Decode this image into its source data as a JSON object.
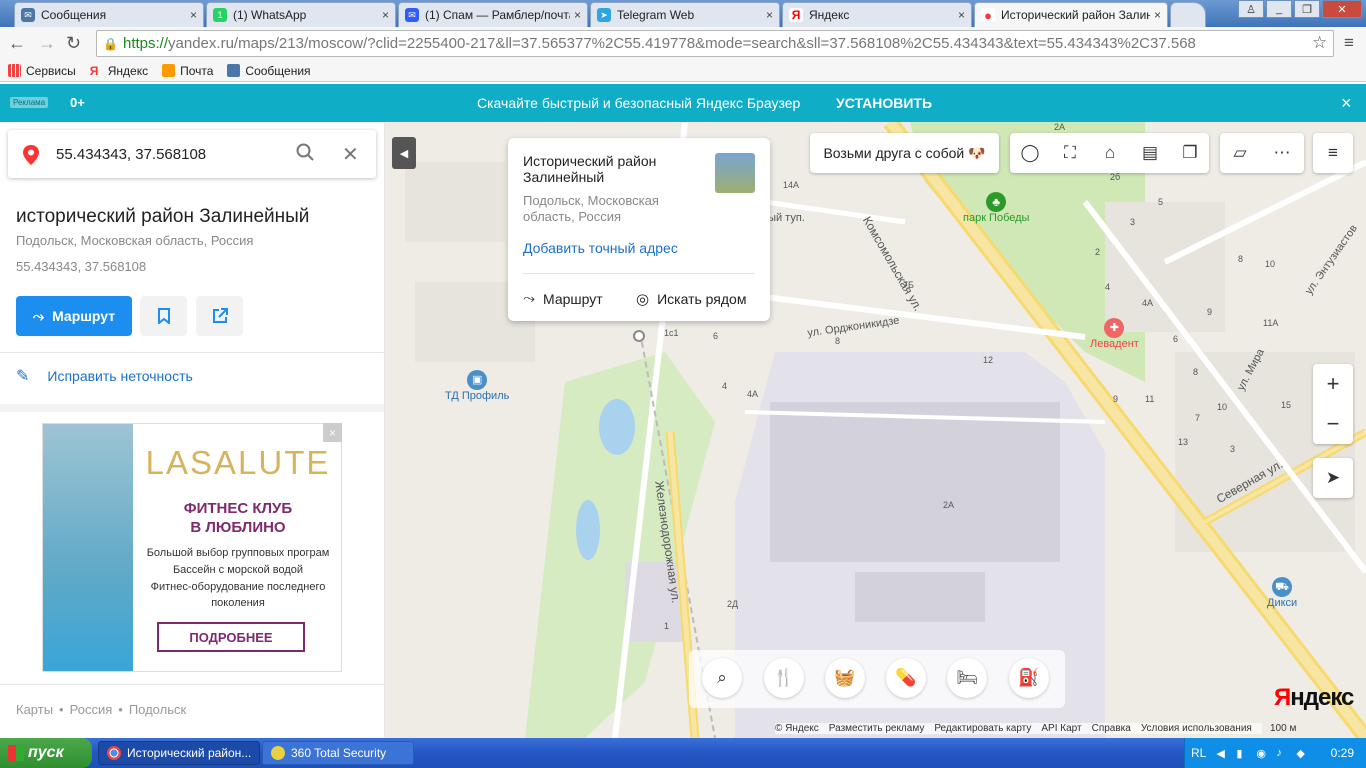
{
  "browser": {
    "tabs": [
      {
        "label": "Сообщения",
        "icon": "message-icon",
        "color": "#4a76a8"
      },
      {
        "label": "(1) WhatsApp",
        "icon": "whatsapp-icon",
        "color": "#25d366"
      },
      {
        "label": "(1) Спам — Рамблер/почта",
        "icon": "mail-icon",
        "color": "#315efb"
      },
      {
        "label": "Telegram Web",
        "icon": "telegram-icon",
        "color": "#2ca5e0"
      },
      {
        "label": "Яндекс",
        "icon": "yandex-icon",
        "color": "#ff0000"
      },
      {
        "label": "Исторический район Залин",
        "icon": "map-pin-icon",
        "color": "#ff3333"
      }
    ],
    "tab_close": "×",
    "url_scheme": "https://",
    "url_rest": "yandex.ru/maps/213/moscow/?clid=2255400-217&ll=37.565377%2C55.419778&mode=search&sll=37.568108%2C55.434343&text=55.434343%2C37.568",
    "bookmarks": [
      {
        "label": "Сервисы",
        "icon": "apps-icon",
        "color": "#e44"
      },
      {
        "label": "Яндекс",
        "icon": "yandex-icon",
        "color": "#f33"
      },
      {
        "label": "Почта",
        "icon": "mail-icon",
        "color": "#f90"
      },
      {
        "label": "Сообщения",
        "icon": "message-icon",
        "color": "#4a76a8"
      }
    ]
  },
  "adbar": {
    "badge": "Реклама",
    "age": "0+",
    "message": "Скачайте быстрый и безопасный Яндекс Браузер",
    "install": "УСТАНОВИТЬ",
    "close": "×",
    "color": "#10adc6"
  },
  "search": {
    "value": "55.434343, 37.568108"
  },
  "place": {
    "title": "исторический район Залинейный",
    "subtitle": "Подольск, Московская область, Россия",
    "coords": "55.434343, 37.568108",
    "route_label": "Маршрут",
    "fix_label": "Исправить неточность"
  },
  "ad": {
    "brand": "LASALUTE",
    "headline1": "ФИТНЕС КЛУБ",
    "headline2": "В ЛЮБЛИНО",
    "lines": [
      "Большой выбор групповых програм",
      "Бассейн с морской водой",
      "Фитнес-оборудование последнего",
      "поколения"
    ],
    "more": "ПОДРОБНЕЕ",
    "close": "×"
  },
  "footer": [
    "Карты",
    "•",
    "Россия",
    "•",
    "Подольск"
  ],
  "popup": {
    "title": "Исторический район Залинейный",
    "subtitle": "Подольск, Московская область, Россия",
    "add_address": "Добавить точный адрес",
    "route": "Маршрут",
    "search_near": "Искать рядом"
  },
  "map": {
    "friend": "Возьми друга с собой 🐶",
    "streets": [
      {
        "name": "ул. Орджоникидзе"
      },
      {
        "name": "Комсомольская ул."
      },
      {
        "name": "Железнодорожная ул."
      },
      {
        "name": "Северная ул."
      },
      {
        "name": "ул. Мира"
      },
      {
        "name": "ул. Энтузиастов"
      },
      {
        "name": "ный туп."
      }
    ],
    "pois": [
      {
        "name": "парк Победы",
        "color": "#2b9a2b"
      },
      {
        "name": "Левадент",
        "color": "#e66"
      },
      {
        "name": "ТД Профиль",
        "color": "#4a90c8"
      },
      {
        "name": "Дикси",
        "color": "#4a90c8"
      }
    ],
    "numbers": [
      "14А",
      "7Б",
      "6",
      "8",
      "12",
      "4",
      "4А",
      "1с1",
      "2А",
      "2Д",
      "1",
      "2",
      "3",
      "4",
      "8",
      "10",
      "4А",
      "9",
      "11А",
      "13",
      "15",
      "10",
      "11",
      "9",
      "2б",
      "3",
      "5",
      "6",
      "2А",
      "8",
      "7",
      "3"
    ],
    "logo_main": "Я",
    "logo_rest": "ндекс",
    "copyright": [
      "© Яндекс",
      "Разместить рекламу",
      "Редактировать карту",
      "API Карт",
      "Справка",
      "Условия использования"
    ],
    "scale": "100 м"
  },
  "taskbar": {
    "start": "пуск",
    "tasks": [
      {
        "label": "Исторический район...",
        "icon": "chrome-icon"
      },
      {
        "label": "360 Total Security",
        "icon": "security-icon"
      }
    ],
    "lang": "RL",
    "clock": "0:29"
  }
}
